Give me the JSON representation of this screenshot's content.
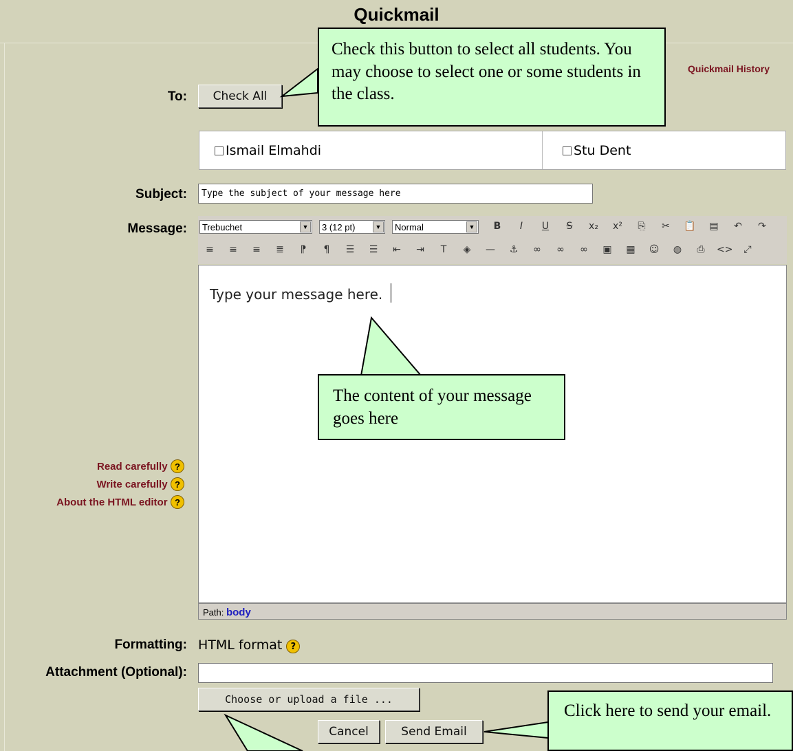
{
  "page": {
    "title": "Quickmail",
    "history_link": "Quickmail History"
  },
  "form": {
    "to_label": "To:",
    "check_all": "Check All",
    "students": [
      "Ismail Elmahdi",
      "Stu Dent"
    ],
    "subject_label": "Subject:",
    "subject_value": "Type the subject of your message here",
    "message_label": "Message:",
    "message_body": "Type your message here.",
    "path_label": "Path:",
    "path_value": "body",
    "formatting_label": "Formatting:",
    "formatting_value": "HTML format",
    "attachment_label": "Attachment (Optional):",
    "attachment_value": "",
    "choose_file": "Choose or upload a file ...",
    "cancel": "Cancel",
    "send": "Send Email"
  },
  "help_links": [
    "Read carefully",
    "Write carefully",
    "About the HTML editor"
  ],
  "editor": {
    "font": "Trebuchet",
    "size": "3 (12 pt)",
    "style": "Normal",
    "row1_icons": [
      {
        "name": "bold-icon",
        "glyph": "B"
      },
      {
        "name": "italic-icon",
        "glyph": "I"
      },
      {
        "name": "underline-icon",
        "glyph": "U"
      },
      {
        "name": "strikethrough-icon",
        "glyph": "S"
      },
      {
        "name": "subscript-icon",
        "glyph": "x₂"
      },
      {
        "name": "superscript-icon",
        "glyph": "x²"
      },
      {
        "name": "copy-icon",
        "glyph": "⎘"
      },
      {
        "name": "cut-icon",
        "glyph": "✂"
      },
      {
        "name": "paste-icon",
        "glyph": "📋"
      },
      {
        "name": "paste-word-icon",
        "glyph": "▤"
      },
      {
        "name": "undo-icon",
        "glyph": "↶"
      },
      {
        "name": "redo-icon",
        "glyph": "↷"
      }
    ],
    "row2_icons": [
      {
        "name": "align-left-icon",
        "glyph": "≡"
      },
      {
        "name": "align-center-icon",
        "glyph": "≡"
      },
      {
        "name": "align-right-icon",
        "glyph": "≡"
      },
      {
        "name": "justify-icon",
        "glyph": "≣"
      },
      {
        "name": "ltr-icon",
        "glyph": "⁋"
      },
      {
        "name": "rtl-icon",
        "glyph": "¶"
      },
      {
        "name": "ordered-list-icon",
        "glyph": "☰"
      },
      {
        "name": "unordered-list-icon",
        "glyph": "☰"
      },
      {
        "name": "outdent-icon",
        "glyph": "⇤"
      },
      {
        "name": "indent-icon",
        "glyph": "⇥"
      },
      {
        "name": "text-color-icon",
        "glyph": "T"
      },
      {
        "name": "highlight-color-icon",
        "glyph": "◈"
      },
      {
        "name": "horizontal-rule-icon",
        "glyph": "—"
      },
      {
        "name": "anchor-icon",
        "glyph": "⚓"
      },
      {
        "name": "link-icon",
        "glyph": "∞"
      },
      {
        "name": "unlink-icon",
        "glyph": "∞"
      },
      {
        "name": "nolink-icon",
        "glyph": "∞"
      },
      {
        "name": "image-icon",
        "glyph": "▣"
      },
      {
        "name": "table-icon",
        "glyph": "▦"
      },
      {
        "name": "smiley-icon",
        "glyph": "☺"
      },
      {
        "name": "special-char-icon",
        "glyph": "◍"
      },
      {
        "name": "search-replace-icon",
        "glyph": "⎙"
      },
      {
        "name": "html-source-icon",
        "glyph": "<>"
      },
      {
        "name": "fullscreen-icon",
        "glyph": "⤢"
      }
    ]
  },
  "callouts": {
    "check_all": "Check this button to select all students. You may choose to select one or some students in the class.",
    "content": "The content of your message goes here",
    "send": "Click here to send your email."
  }
}
